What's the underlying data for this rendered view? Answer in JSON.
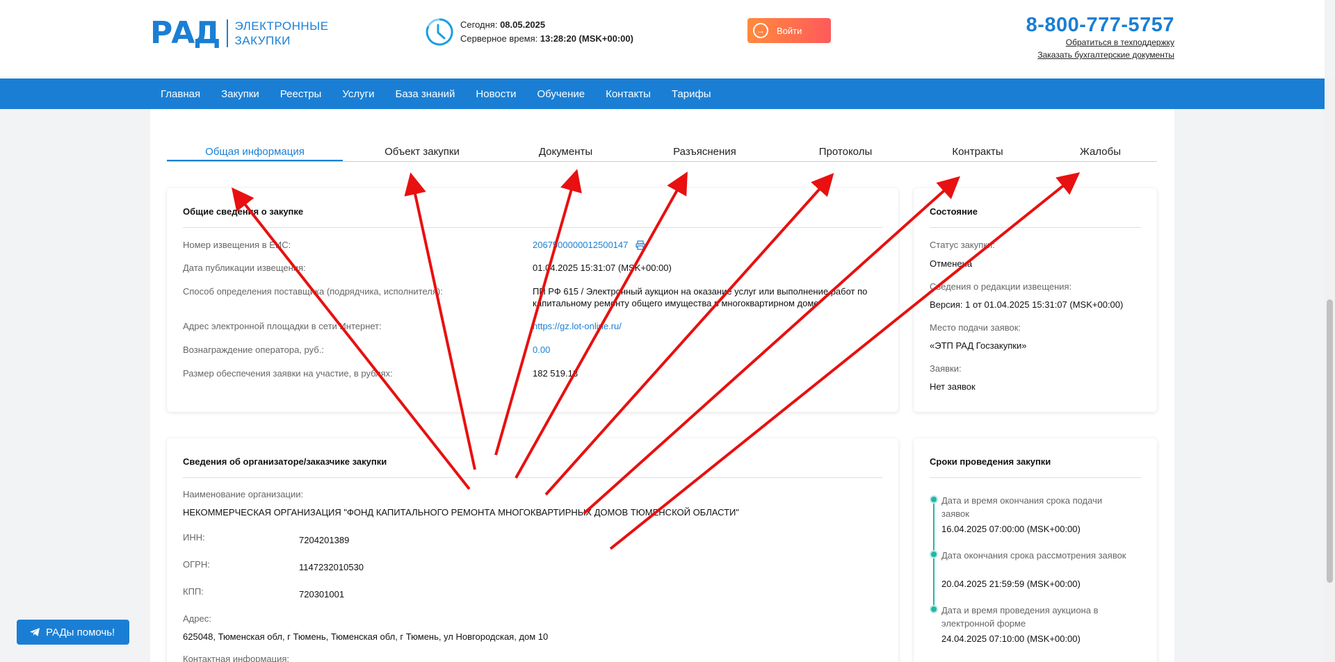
{
  "header": {
    "logo_mark": "РАД",
    "logo_line1": "ЭЛЕКТРОННЫЕ",
    "logo_line2": "ЗАКУПКИ",
    "today_label": "Сегодня:",
    "today_value": "08.05.2025",
    "server_label": "Серверное время:",
    "server_value": "13:28:20 (MSK+00:00)",
    "login_label": "Войти",
    "phone": "8-800-777-5757",
    "support_link": "Обратиться в техподдержку",
    "docs_link": "Заказать бухгалтерские документы"
  },
  "nav": [
    "Главная",
    "Закупки",
    "Реестры",
    "Услуги",
    "База знаний",
    "Новости",
    "Обучение",
    "Контакты",
    "Тарифы"
  ],
  "tabs": [
    "Общая информация",
    "Объект закупки",
    "Документы",
    "Разъяснения",
    "Протоколы",
    "Контракты",
    "Жалобы"
  ],
  "general": {
    "title": "Общие сведения о закупке",
    "rows": [
      {
        "label": "Номер извещения в ЕИС:",
        "value": "2067500000012500147"
      },
      {
        "label": "Дата публикации извещения:",
        "value": "01.04.2025 15:31:07 (MSK+00:00)"
      },
      {
        "label": "Способ определения поставщика (подрядчика, исполнителя):",
        "value": "ПП РФ 615 / Электронный аукцион на оказание услуг или выполнение работ по капитальному ремонту общего имущества в многоквартирном доме"
      },
      {
        "label": "Адрес электронной площадки в сети Интернет:",
        "value": "https://gz.lot-online.ru/"
      },
      {
        "label": "Вознаграждение оператора, руб.:",
        "value": "0.00"
      },
      {
        "label": "Размер обеспечения заявки на участие, в рублях:",
        "value": "182 519.13"
      }
    ]
  },
  "state": {
    "title": "Состояние",
    "rows": [
      {
        "label": "Статус закупки:",
        "value": "Отменена"
      },
      {
        "label": "Сведения о редакции извещения:",
        "value": "Версия: 1 от 01.04.2025 15:31:07 (MSK+00:00)"
      },
      {
        "label": "Место подачи заявок:",
        "value": "«ЭТП РАД Госзакупки»"
      },
      {
        "label": "Заявки:",
        "value": "Нет заявок"
      }
    ]
  },
  "organizer": {
    "title": "Сведения об организаторе/заказчике закупки",
    "name_label": "Наименование организации:",
    "name_value": "НЕКОММЕРЧЕСКАЯ ОРГАНИЗАЦИЯ \"ФОНД КАПИТАЛЬНОГО РЕМОНТА МНОГОКВАРТИРНЫХ ДОМОВ ТЮМЕНСКОЙ ОБЛАСТИ\"",
    "inn_label": "ИНН:",
    "inn_value": "7204201389",
    "ogrn_label": "ОГРН:",
    "ogrn_value": "1147232010530",
    "kpp_label": "КПП:",
    "kpp_value": "720301001",
    "address_label": "Адрес:",
    "address_value": "625048, Тюменская обл, г Тюмень, Тюменская обл, г Тюмень, ул Новгородская, дом 10",
    "contact_label": "Контактная информация:"
  },
  "deadlines": {
    "title": "Сроки проведения закупки",
    "items": [
      {
        "label": "Дата и время окончания срока подачи заявок",
        "value": "16.04.2025 07:00:00 (MSK+00:00)"
      },
      {
        "label": "Дата окончания срока рассмотрения заявок",
        "value": "20.04.2025 21:59:59 (MSK+00:00)"
      },
      {
        "label": "Дата и время проведения аукциона в электронной форме",
        "value": "24.04.2025 07:10:00 (MSK+00:00)"
      }
    ]
  },
  "help_button": "РАДы помочь!",
  "colors": {
    "brand": "#1a7fd4",
    "accent": "#ff5a5a",
    "annotation": "#e81010",
    "timeline": "#22b6a8"
  }
}
